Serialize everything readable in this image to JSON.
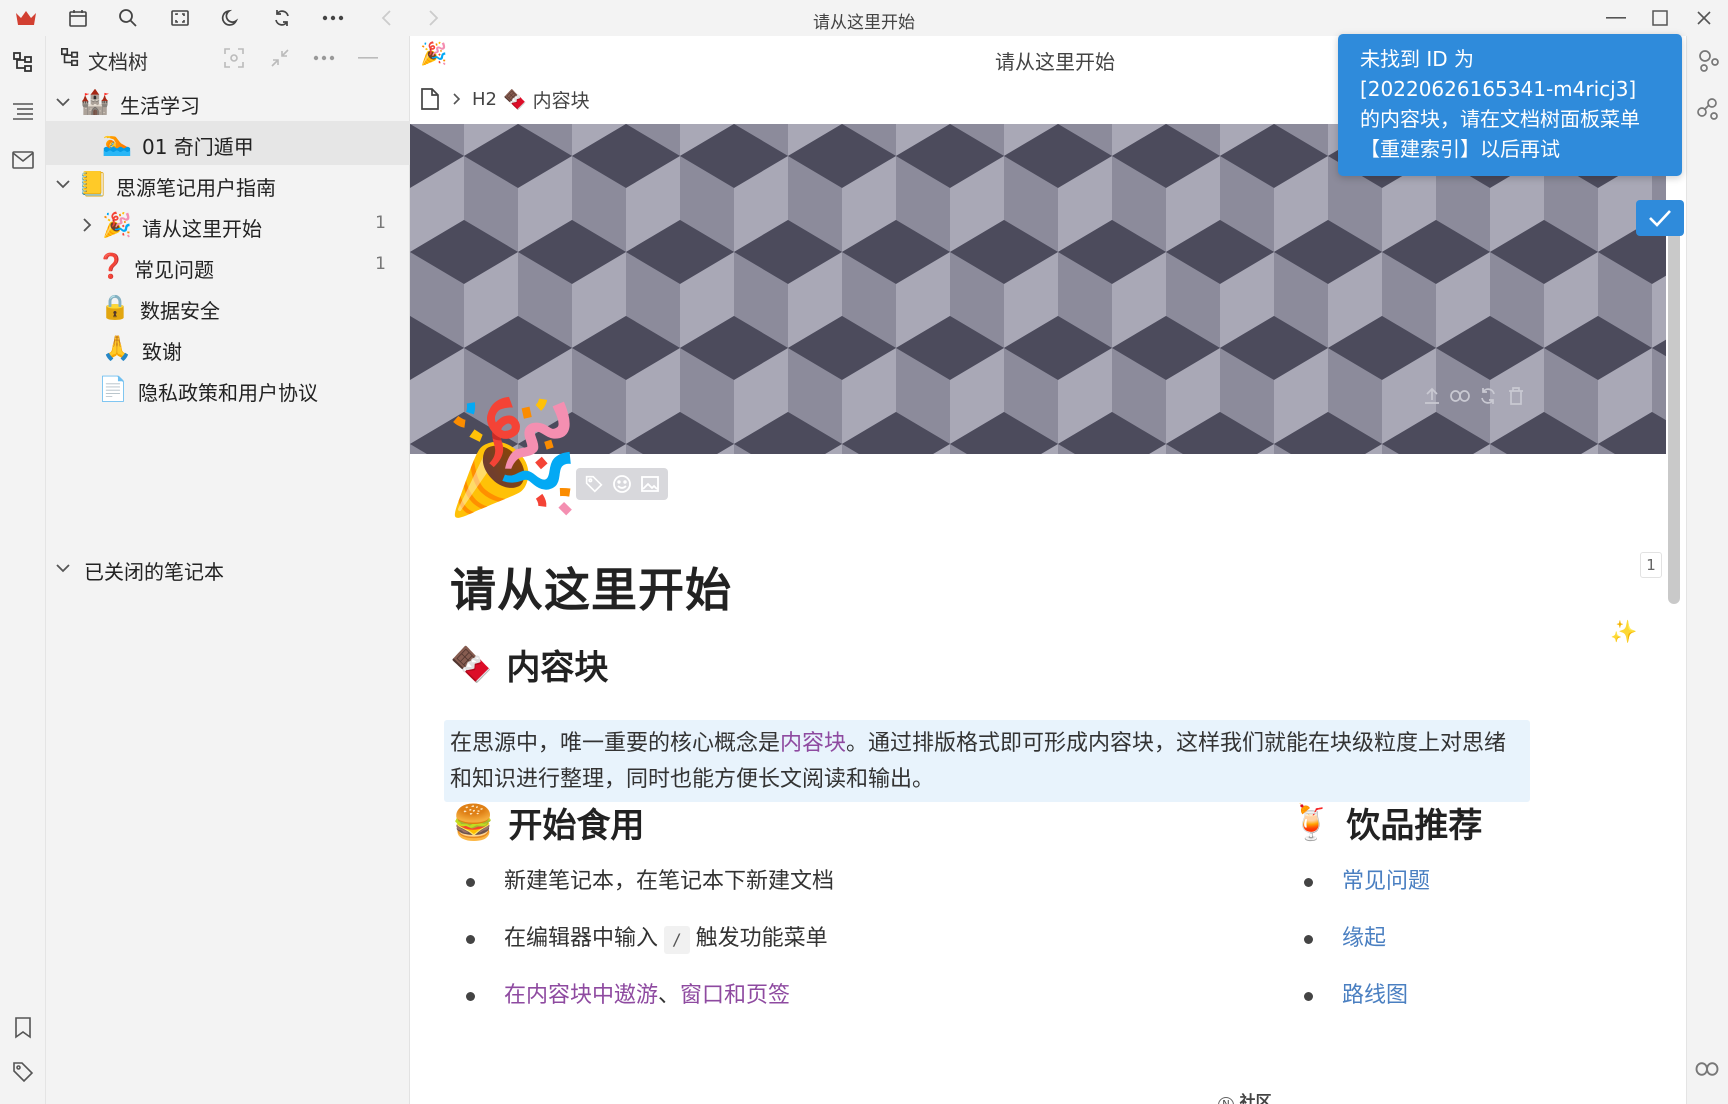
{
  "window": {
    "title": "请从这里开始"
  },
  "file_tree": {
    "header_label": "文档树",
    "notebooks": [
      {
        "label": "生活学习",
        "icon": "🏰"
      },
      {
        "label": "思源笔记用户指南",
        "icon": "📒"
      },
      {
        "label": "已关闭的笔记本"
      }
    ],
    "docs": [
      {
        "label": "01 奇门遁甲",
        "icon": "🏊"
      },
      {
        "label": "请从这里开始",
        "icon": "🎉",
        "count": "1"
      },
      {
        "label": "常见问题",
        "icon": "❓",
        "count": "1"
      },
      {
        "label": "数据安全",
        "icon": "🔒"
      },
      {
        "label": "致谢",
        "icon": "🙏"
      },
      {
        "label": "隐私政策和用户协议",
        "icon": "📄"
      }
    ]
  },
  "editor": {
    "doc_header_title": "请从这里开始",
    "breadcrumb": {
      "heading_tag": "H2",
      "block_label": "内容块",
      "block_icon": "🍫"
    },
    "page_icon": "🎉",
    "page_title": "请从这里开始",
    "title_count": "1",
    "sections": {
      "content_block": {
        "heading": "内容块",
        "heading_icon": "🍫",
        "para_part1": "在思源中，唯一重要的核心概念是",
        "para_link": "内容块",
        "para_part2": "。通过排版格式即可形成内容块，这样我们就能在块级粒度上对思绪和知识进行整理，同时也能方便长文阅读和输出。"
      },
      "start_using": {
        "heading": "开始食用",
        "heading_icon": "🍔",
        "item1": "新建笔记本，在笔记本下新建文档",
        "item2_before": "在编辑器中输入",
        "item2_kbd": "/",
        "item2_after": "触发功能菜单",
        "item3_link1": "在内容块中遨游",
        "item3_sep": "、",
        "item3_link2": "窗口和页签"
      },
      "drinks": {
        "heading": "饮品推荐",
        "heading_icon": "🍹",
        "items": [
          "常见问题",
          "缘起",
          "路线图"
        ]
      }
    },
    "bottom_partial_label": "社区"
  },
  "toast": {
    "message": "未找到 ID 为 [20220626165341-m4ricj3] 的内容块，请在文档树面板菜单【重建索引】以后再试"
  },
  "colors": {
    "accent": "#2f8bdb",
    "link_purple": "#8e4aa0",
    "link_blue": "#4a7fc1",
    "highlight_block": "#e8f3fc"
  }
}
